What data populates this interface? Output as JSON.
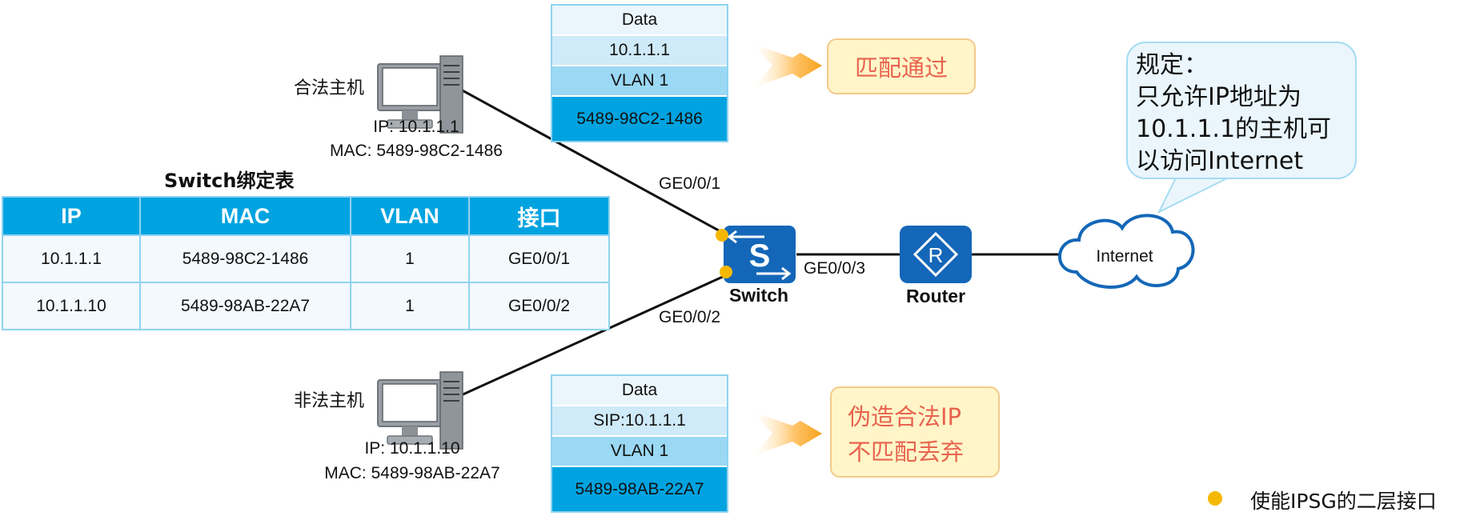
{
  "hosts": {
    "legal": {
      "label": "合法主机",
      "ip": "IP: 10.1.1.1",
      "mac": "MAC: 5489-98C2-1486"
    },
    "illegal": {
      "label": "非法主机",
      "ip": "IP: 10.1.1.10",
      "mac": "MAC: 5489-98AB-22A7"
    }
  },
  "packets": {
    "top": [
      "Data",
      "10.1.1.1",
      "VLAN 1",
      "5489-98C2-1486"
    ],
    "bottom": [
      "Data",
      "SIP:10.1.1.1",
      "VLAN 1",
      "5489-98AB-22A7"
    ]
  },
  "callouts": {
    "pass": "匹配通过",
    "drop_line1": "伪造合法IP",
    "drop_line2": "不匹配丢弃"
  },
  "table": {
    "title": "Switch绑定表",
    "headers": [
      "IP",
      "MAC",
      "VLAN",
      "接口"
    ],
    "rows": [
      [
        "10.1.1.1",
        "5489-98C2-1486",
        "1",
        "GE0/0/1"
      ],
      [
        "10.1.1.10",
        "5489-98AB-22A7",
        "1",
        "GE0/0/2"
      ]
    ]
  },
  "ports": {
    "p1": "GE0/0/1",
    "p2": "GE0/0/2",
    "p3": "GE0/0/3"
  },
  "devices": {
    "switch": "Switch",
    "router": "Router",
    "internet": "Internet",
    "switch_glyph": "S",
    "router_glyph": "R"
  },
  "rule": {
    "lines": [
      "规定：",
      "只允许IP地址为",
      "10.1.1.1的主机可",
      "以访问Internet"
    ]
  },
  "legend": {
    "label": "使能IPSG的二层接口"
  },
  "colors": {
    "accent": "#00a3e0",
    "dot": "#f5b800",
    "callout_text": "#e8634f",
    "device": "#1467b8"
  }
}
